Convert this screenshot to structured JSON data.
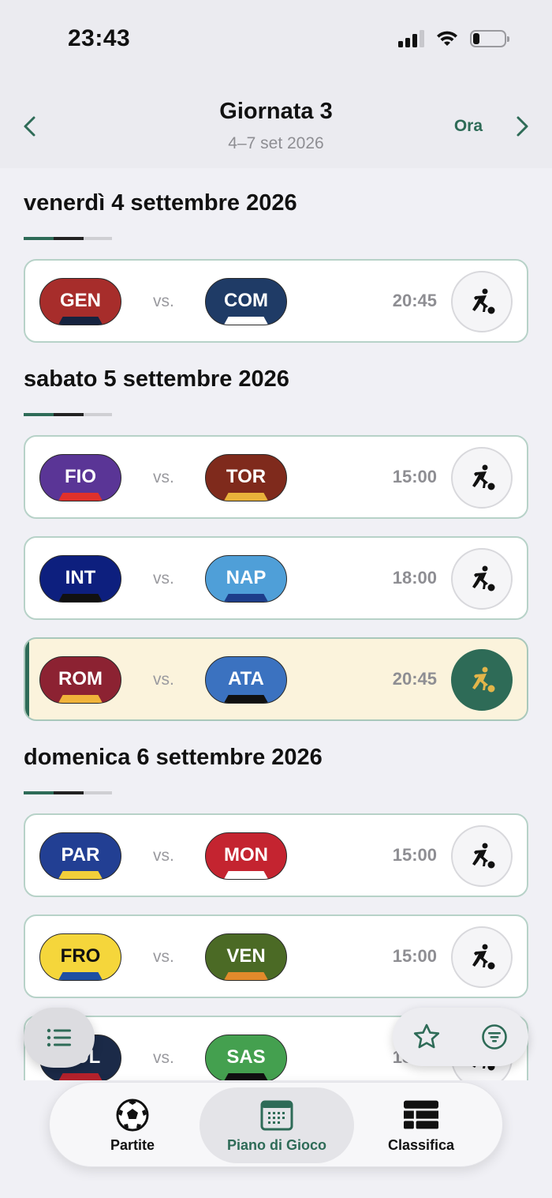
{
  "status_bar": {
    "time": "23:43",
    "battery_level": 0.2
  },
  "header": {
    "title": "Giornata 3",
    "subtitle": "4–7 set 2026",
    "now_label": "Ora"
  },
  "days": [
    {
      "title": "venerdì 4 settembre 2026",
      "matches": [
        {
          "home": "GEN",
          "away": "COM",
          "time": "20:45",
          "home_color": "#a72d2b",
          "home_stripe": "#16233f",
          "away_color": "#1f3b66",
          "away_stripe": "#ffffff",
          "highlight": false
        }
      ]
    },
    {
      "title": "sabato 5 settembre 2026",
      "matches": [
        {
          "home": "FIO",
          "away": "TOR",
          "time": "15:00",
          "home_color": "#5a3596",
          "home_stripe": "#e0312b",
          "away_color": "#7f2a1c",
          "away_stripe": "#e9b23a",
          "highlight": false
        },
        {
          "home": "INT",
          "away": "NAP",
          "time": "18:00",
          "home_color": "#0d1f7e",
          "home_stripe": "#111111",
          "away_color": "#4f9fd8",
          "away_stripe": "#1d3d8a",
          "highlight": false
        },
        {
          "home": "ROM",
          "away": "ATA",
          "time": "20:45",
          "home_color": "#8c2232",
          "home_stripe": "#f0b33a",
          "away_color": "#3b72c0",
          "away_stripe": "#111111",
          "highlight": true
        }
      ]
    },
    {
      "title": "domenica 6 settembre 2026",
      "matches": [
        {
          "home": "PAR",
          "away": "MON",
          "time": "15:00",
          "home_color": "#223f93",
          "home_stripe": "#f2cf3a",
          "away_color": "#c42430",
          "away_stripe": "#ffffff",
          "highlight": false
        },
        {
          "home": "FRO",
          "away": "VEN",
          "time": "15:00",
          "home_color": "#f5d63b",
          "home_stripe": "#1e4fa3",
          "away_color": "#4b6a25",
          "away_stripe": "#e28a2b",
          "highlight": false,
          "home_text_dark": true
        },
        {
          "home": "BOL",
          "away": "SAS",
          "time": "18:00",
          "home_color": "#1b2a48",
          "home_stripe": "#b5222c",
          "away_color": "#44a04f",
          "away_stripe": "#111111",
          "highlight": false
        }
      ]
    }
  ],
  "vs_label": "vs.",
  "colors": {
    "accent": "#2e6b57",
    "card_border": "#b7d2c8",
    "highlight_bg": "#fbf3dc",
    "underline_green": "#2e6b57",
    "underline_dark": "#222222",
    "underline_gray": "#cfcfd3"
  },
  "icons": {
    "back": "chevron-left-icon",
    "forward": "chevron-right-icon",
    "kickoff": "football-player-icon",
    "list": "list-icon",
    "star": "star-icon",
    "filter": "filter-icon"
  },
  "tabs": [
    {
      "label": "Partite",
      "icon": "soccer-ball-icon",
      "selected": false
    },
    {
      "label": "Piano di Gioco",
      "icon": "calendar-icon",
      "selected": true
    },
    {
      "label": "Classifica",
      "icon": "table-icon",
      "selected": false
    }
  ]
}
